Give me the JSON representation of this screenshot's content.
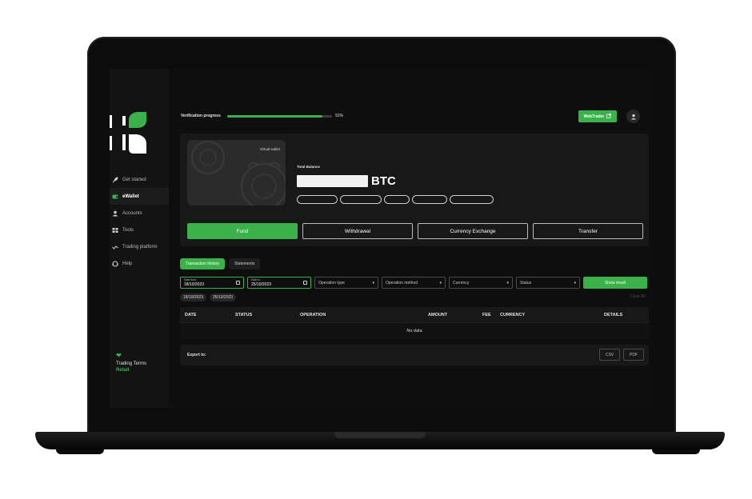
{
  "sidebar": {
    "items": [
      {
        "icon": "rocket-icon",
        "label": "Get started"
      },
      {
        "icon": "wallet-icon",
        "label": "eWallet"
      },
      {
        "icon": "user-icon",
        "label": "Accounts"
      },
      {
        "icon": "tools-icon",
        "label": "Tools"
      },
      {
        "icon": "chart-icon",
        "label": "Trading platform"
      },
      {
        "icon": "help-icon",
        "label": "Help"
      }
    ],
    "active_item": "eWallet",
    "terms": {
      "label": "Trading Terms",
      "value": "Retail"
    }
  },
  "header": {
    "verification_label": "Verification progress",
    "verification_value": 0.91,
    "verification_percent_text": "91%",
    "webtrader_label": "WebTrader"
  },
  "balance": {
    "card_label": "Virtual wallet",
    "total_label": "Total Balance",
    "currency": "BTC"
  },
  "actions": {
    "fund": "Fund",
    "withdrawal": "Withdrawal",
    "exchange": "Currency Exchange",
    "transfer": "Transfer"
  },
  "tabs": [
    "Transaction history",
    "Statements"
  ],
  "filters": {
    "date_from_label": "Date from",
    "date_from": "18/10/2023",
    "date_to_label": "Date to",
    "date_to": "25/10/2023",
    "operation_type": "Operation type",
    "operation_method": "Operation method",
    "currency": "Currency",
    "status": "Status",
    "show_result": "Show result"
  },
  "chips": [
    "18/10/2023",
    "25/10/2023"
  ],
  "clear_all": "Clear All",
  "table": {
    "headers": {
      "date": "DATE",
      "status": "STATUS",
      "operation": "OPERATION",
      "amount": "AMOUNT",
      "fee": "FEE",
      "currency": "CURRENCY",
      "details": "DETAILS"
    },
    "empty_text": "No data"
  },
  "export": {
    "label": "Export to:",
    "csv": "CSV",
    "pdf": "PDF"
  },
  "colors": {
    "accent": "#3bb14a",
    "background": "#0e0e0e",
    "panel": "#181818"
  }
}
